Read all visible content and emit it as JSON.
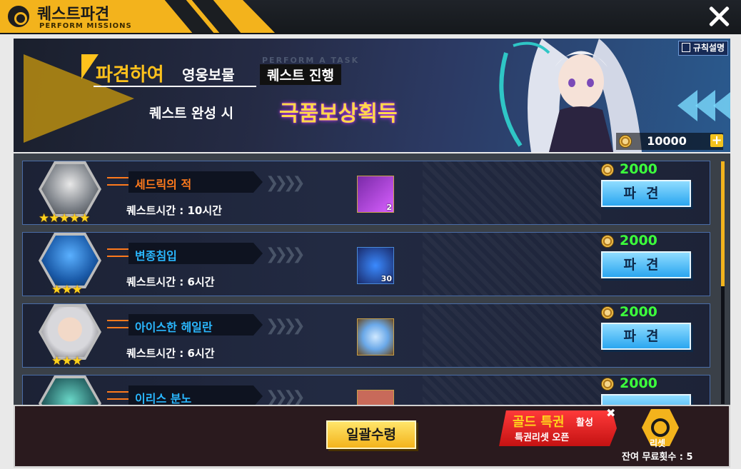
{
  "header": {
    "title": "퀘스트파견",
    "subtitle": "PERFORM MISSIONS"
  },
  "banner": {
    "line1_highlight": "파견하여",
    "line1_rest": "영웅보물",
    "line1_box": "퀘스트 진행",
    "tagline": "PERFORM A TASK",
    "line2_left": "퀘스트 완성 시",
    "line2_right": "극품보상획득",
    "rules_button": "규칙설명",
    "currency_amount": "10000"
  },
  "quests": [
    {
      "hero_name": "세드릭의 적",
      "name_color": "#ff7a1c",
      "stars": "★★★★★",
      "time_label": "퀘스트시간 :",
      "time_value": "10시간",
      "item_count": "2",
      "cost": "2000",
      "dispatch_label": "파견",
      "icon": "mech-hero-icon"
    },
    {
      "hero_name": "변종침입",
      "name_color": "#2ab8ff",
      "stars": "★★★",
      "time_label": "퀘스트시간 :",
      "time_value": "6시간",
      "item_count": "30",
      "cost": "2000",
      "dispatch_label": "파견",
      "icon": "robot-hero-icon"
    },
    {
      "hero_name": "아이스한 헤일란",
      "name_color": "#2ab8ff",
      "stars": "★★★",
      "time_label": "퀘스트시간 :",
      "time_value": "6시간",
      "item_count": "",
      "cost": "2000",
      "dispatch_label": "파견",
      "icon": "silver-hair-hero-icon"
    },
    {
      "hero_name": "이리스 분노",
      "name_color": "#2ab8ff",
      "stars": "",
      "time_label": "",
      "time_value": "",
      "item_count": "",
      "cost": "2000",
      "dispatch_label": "",
      "icon": "teal-hero-icon"
    }
  ],
  "footer": {
    "claim_all": "일괄수령",
    "gold_title": "골드 특권",
    "gold_title_suffix": "활성",
    "gold_sub": "특권리셋 오픈",
    "reset_label": "리셋",
    "remaining_label": "잔여 무료횟수 : 5"
  },
  "colors": {
    "accent_yellow": "#f3b31c",
    "cost_green": "#3cff3c",
    "dispatch_blue": "#2aa6f0",
    "gold_red": "#d41818"
  }
}
